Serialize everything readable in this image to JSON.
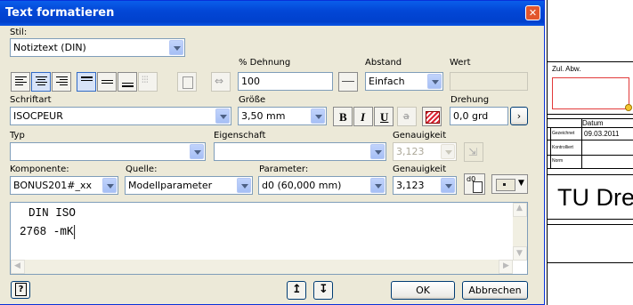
{
  "dialog": {
    "title": "Text formatieren",
    "stil": {
      "label": "Stil:",
      "value": "Notiztext (DIN)"
    },
    "dehnung": {
      "label": "% Dehnung",
      "value": "100"
    },
    "abstand": {
      "label": "Abstand",
      "value": "Einfach"
    },
    "wert": {
      "label": "Wert",
      "value": ""
    },
    "schriftart": {
      "label": "Schriftart",
      "value": "ISOCPEUR"
    },
    "groesse": {
      "label": "Größe",
      "value": "3,50 mm"
    },
    "drehung": {
      "label": "Drehung",
      "value": "0,0 grd"
    },
    "typ": {
      "label": "Typ",
      "value": ""
    },
    "eigenschaft": {
      "label": "Eigenschaft",
      "value": ""
    },
    "genauigkeit1": {
      "label": "Genauigkeit",
      "value": "3,123"
    },
    "komponente": {
      "label": "Komponente:",
      "value": "BONUS201#_xx"
    },
    "quelle": {
      "label": "Quelle:",
      "value": "Modellparameter"
    },
    "parameter": {
      "label": "Parameter:",
      "value": "d0 (60,000 mm)"
    },
    "genauigkeit2": {
      "label": "Genauigkeit",
      "value": "3,123"
    },
    "param_icon_label": "d0",
    "format_buttons": {
      "bold": "B",
      "italic": "I",
      "underline": "U"
    },
    "editor": {
      "line1": "DIN ISO",
      "line2": "2768 -mK"
    },
    "ok_label": "OK",
    "cancel_label": "Abbrechen",
    "help_label": "?"
  },
  "drawing": {
    "zul_abw": "Zul. Abw.",
    "datum": "Datum",
    "date_value": "09.03.2011",
    "row1": "Gezeichnet",
    "row2": "Kontrolliert",
    "row3": "Norm",
    "tu_label": "TU Dres"
  },
  "colors": {
    "titlebar": "#0347d6",
    "dialog_bg": "#ece9d8",
    "swatch": "#808080"
  }
}
